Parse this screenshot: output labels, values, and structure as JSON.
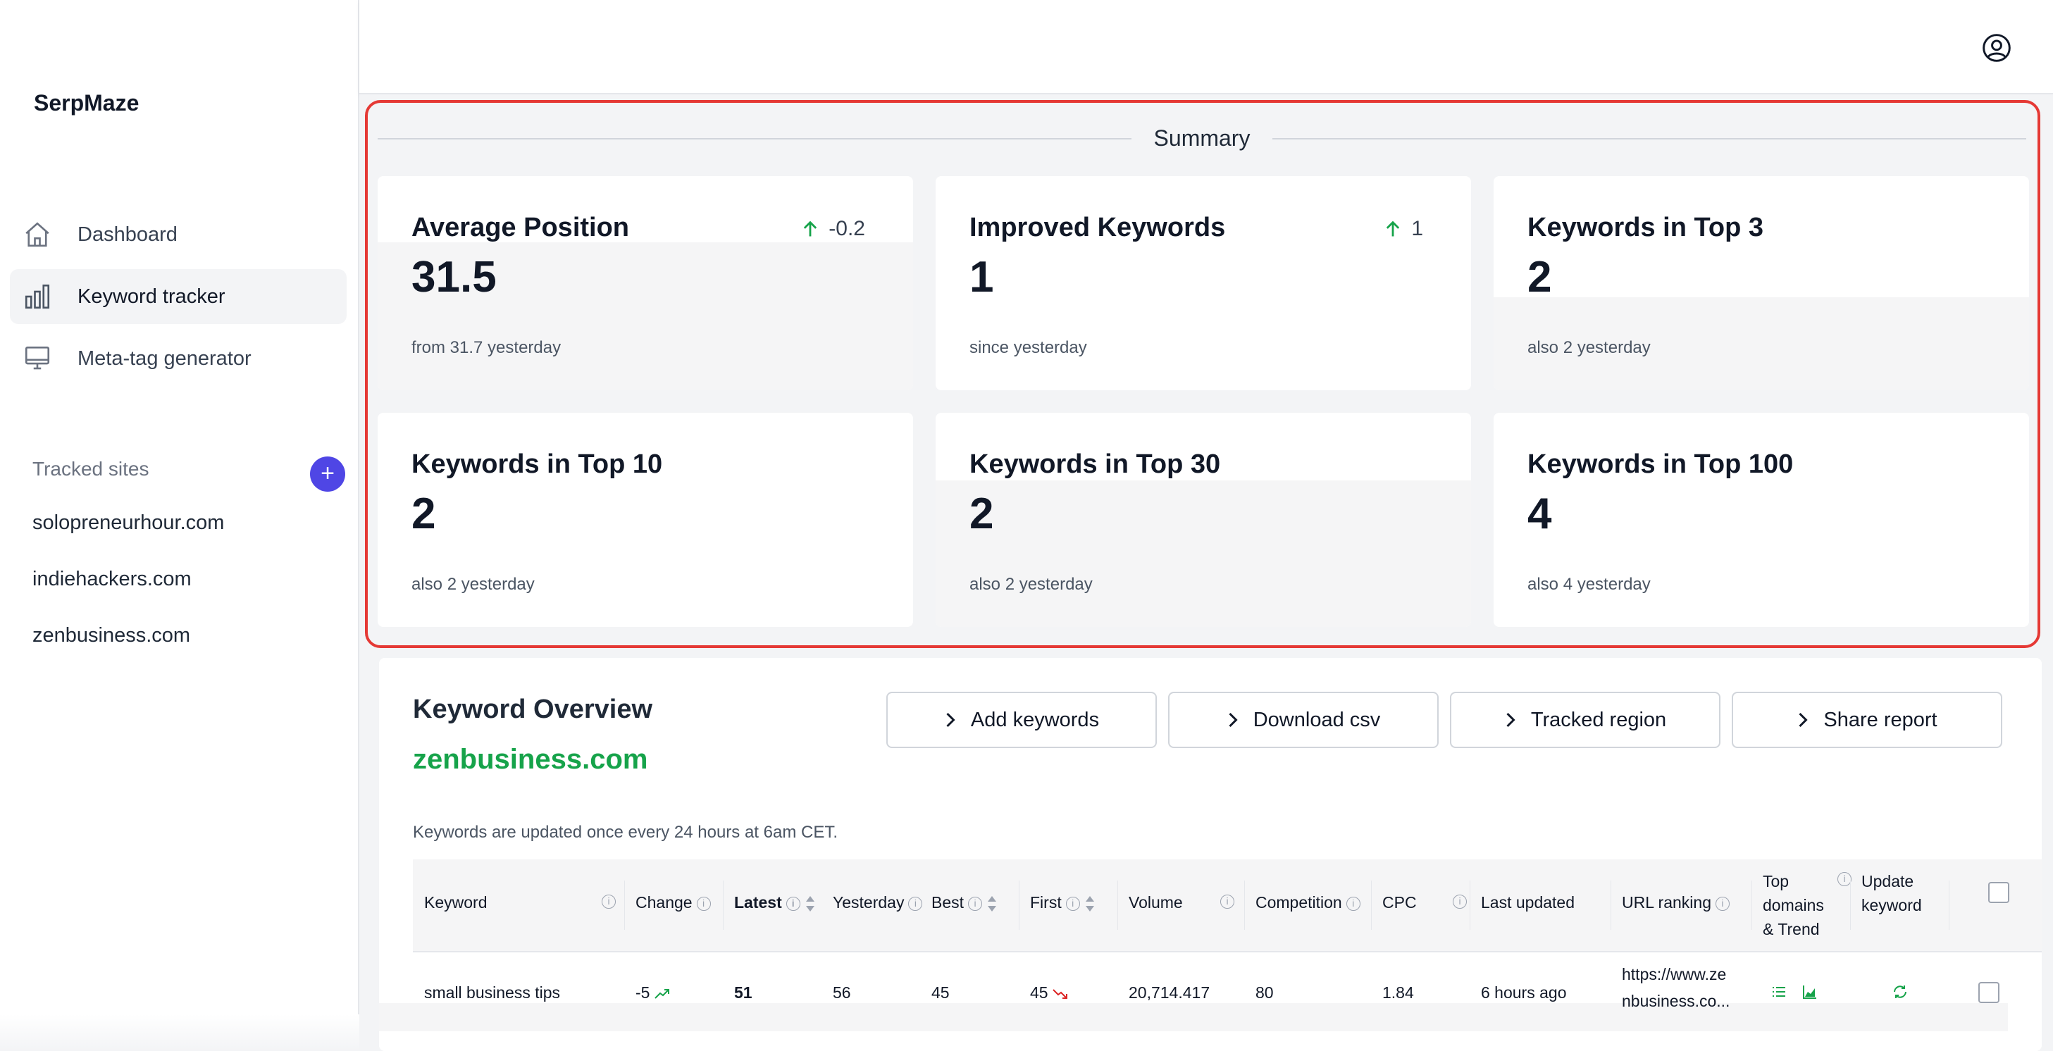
{
  "app": {
    "name": "SerpMaze"
  },
  "nav": [
    {
      "label": "Dashboard",
      "icon": "home-icon",
      "active": false
    },
    {
      "label": "Keyword tracker",
      "icon": "bar-chart-icon",
      "active": true
    },
    {
      "label": "Meta-tag generator",
      "icon": "monitor-icon",
      "active": false
    }
  ],
  "tracked": {
    "title": "Tracked sites",
    "add_label": "+",
    "sites": [
      "solopreneurhour.com",
      "indiehackers.com",
      "zenbusiness.com"
    ]
  },
  "summary": {
    "title": "Summary",
    "cards": [
      {
        "title": "Average Position",
        "value": "31.5",
        "sub": "from 31.7 yesterday",
        "delta": "-0.2"
      },
      {
        "title": "Improved Keywords",
        "value": "1",
        "sub": "since yesterday",
        "delta": "1"
      },
      {
        "title": "Keywords in Top 3",
        "value": "2",
        "sub": "also 2 yesterday"
      },
      {
        "title": "Keywords in Top 10",
        "value": "2",
        "sub": "also 2 yesterday"
      },
      {
        "title": "Keywords in Top 30",
        "value": "2",
        "sub": "also 2 yesterday"
      },
      {
        "title": "Keywords in Top 100",
        "value": "4",
        "sub": "also 4 yesterday"
      }
    ]
  },
  "overview": {
    "title": "Keyword Overview",
    "site": "zenbusiness.com",
    "note": "Keywords are updated once every 24 hours at 6am CET.",
    "buttons": [
      "Add keywords",
      "Download csv",
      "Tracked region",
      "Share report"
    ]
  },
  "table": {
    "headers": [
      "Keyword",
      "Change",
      "Latest",
      "Yesterday",
      "Best",
      "First",
      "Volume",
      "Competition",
      "CPC",
      "Last updated",
      "URL ranking",
      "Top domains & Trend",
      "Update keyword"
    ],
    "rows": [
      {
        "keyword": "small business tips",
        "change": "-5",
        "latest": "51",
        "yesterday": "56",
        "best": "45",
        "first": "45",
        "volume": "20,714.417",
        "competition": "80",
        "cpc": "1.84",
        "last_updated": "6 hours ago",
        "url_line1": "https://www.ze",
        "url_line2": "nbusiness.co..."
      }
    ]
  },
  "colors": {
    "accent": "#4f46e5",
    "brand_green": "#16a34a",
    "highlight": "#e53935",
    "up": "#16a34a",
    "down": "#dc2626"
  }
}
